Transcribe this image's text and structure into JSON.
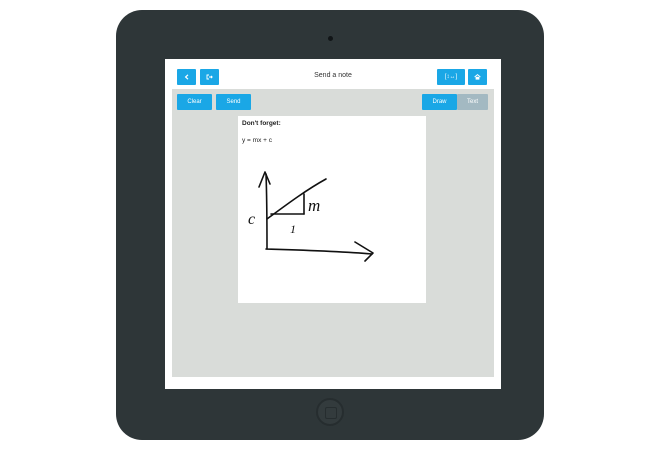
{
  "header": {
    "title": "Send a note",
    "back_icon": "chevron-left-icon",
    "signout_icon": "sign-out-icon",
    "zoom_label": "[↕↔]",
    "home_icon": "home-icon"
  },
  "toolbar": {
    "clear_label": "Clear",
    "send_label": "Send",
    "mode_draw_label": "Draw",
    "mode_text_label": "Text",
    "active_mode": "Draw"
  },
  "note": {
    "heading": "Don't forget:",
    "equation": "y = mx + c",
    "sketch_labels": {
      "m": "m",
      "one": "1",
      "c": "c"
    }
  },
  "colors": {
    "accent": "#1aa7e6",
    "inactive": "#a3b9c2",
    "canvas_bg": "#d9dcd9",
    "device": "#2e3638"
  }
}
